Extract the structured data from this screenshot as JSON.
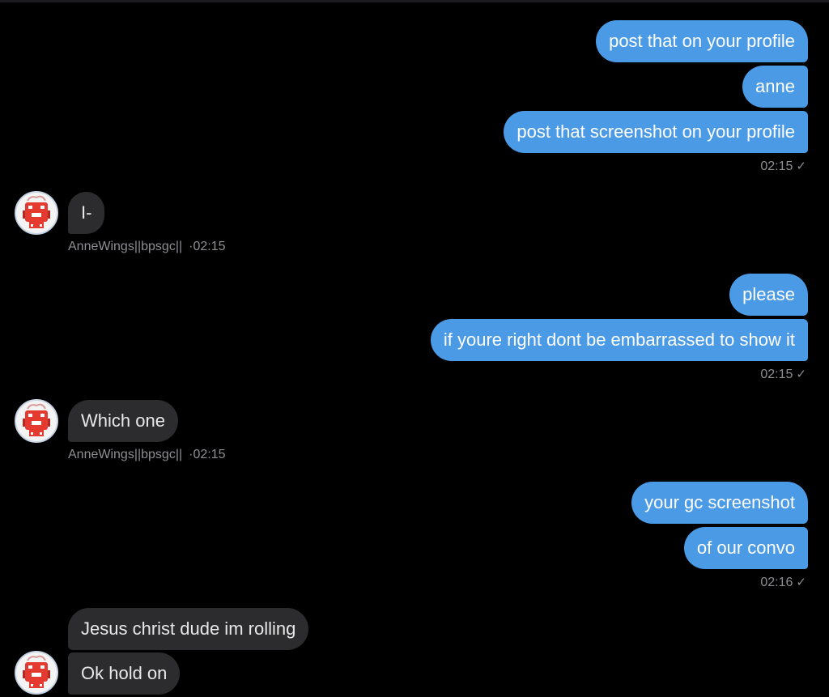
{
  "colors": {
    "background": "#000000",
    "sent_bubble": "#4a9ae6",
    "received_bubble": "#2c2c2e",
    "meta_text": "#8e8e93"
  },
  "icons": {
    "avatar": "avatar-red-robot-icon",
    "read_receipt": "checkmark-icon"
  },
  "conversation": {
    "group1": {
      "messages": [
        "post that on your profile",
        "anne",
        "post that screenshot on your profile"
      ],
      "time": "02:15",
      "check": "✓"
    },
    "reply1": {
      "messages": [
        "I-"
      ],
      "sender": "AnneWings||bpsgc||",
      "dot": "·",
      "time": "02:15"
    },
    "group2": {
      "messages": [
        "please",
        "if youre right dont be embarrassed to show it"
      ],
      "time": "02:15",
      "check": "✓"
    },
    "reply2": {
      "messages": [
        "Which one"
      ],
      "sender": "AnneWings||bpsgc||",
      "dot": "·",
      "time": "02:15"
    },
    "group3": {
      "messages": [
        "your gc screenshot",
        "of our convo"
      ],
      "time": "02:16",
      "check": "✓"
    },
    "reply3": {
      "messages": [
        "Jesus christ dude im rolling",
        "Ok hold on"
      ]
    }
  }
}
